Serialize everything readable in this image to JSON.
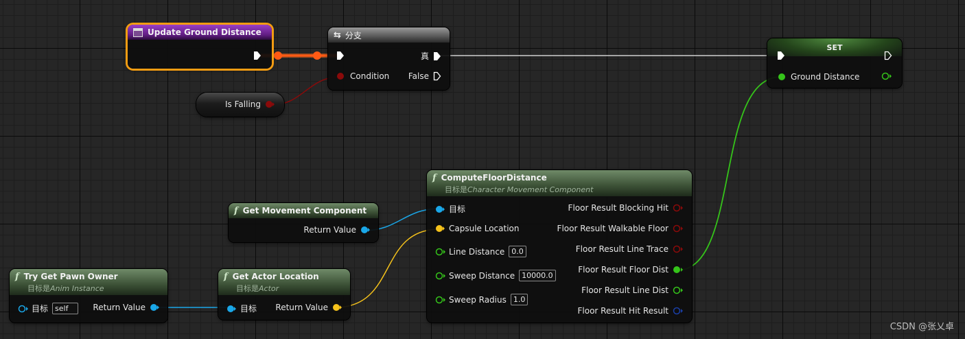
{
  "colors": {
    "exec": "#ffffff",
    "bool_pin": "#8a0a0a",
    "float_pin": "#35c41a",
    "object_pin": "#1aa7e8",
    "vector_pin": "#f5c21b",
    "struct_pin": "#1a3fa8",
    "event_header": "#7a1fa6",
    "selection_outline": "#f39c12",
    "exec_wire_active": "#ff5a14"
  },
  "nodes": {
    "update_ground_distance": {
      "title": "Update Ground Distance",
      "icon": "event-icon"
    },
    "branch": {
      "title": "分支",
      "icon": "branch-icon",
      "condition_label": "Condition",
      "true_label": "真",
      "false_label": "False"
    },
    "is_falling": {
      "label": "Is Falling"
    },
    "set": {
      "title": "SET",
      "var_label": "Ground Distance"
    },
    "get_movement_component": {
      "title": "Get Movement Component",
      "return_label": "Return Value"
    },
    "compute_floor_distance": {
      "title": "ComputeFloorDistance",
      "subtitle_prefix": "目标是",
      "subtitle": "Character Movement Component",
      "inputs": {
        "target": "目标",
        "capsule_location": "Capsule Location",
        "line_distance": "Line Distance",
        "line_distance_value": "0.0",
        "sweep_distance": "Sweep Distance",
        "sweep_distance_value": "10000.0",
        "sweep_radius": "Sweep Radius",
        "sweep_radius_value": "1.0"
      },
      "outputs": {
        "blocking_hit": "Floor Result Blocking Hit",
        "walkable_floor": "Floor Result Walkable Floor",
        "line_trace": "Floor Result Line Trace",
        "floor_dist": "Floor Result Floor Dist",
        "line_dist": "Floor Result Line Dist",
        "hit_result": "Floor Result Hit Result"
      }
    },
    "try_get_pawn_owner": {
      "title": "Try Get Pawn Owner",
      "subtitle_prefix": "目标是",
      "subtitle": "Anim Instance",
      "target_label": "目标",
      "target_value": "self",
      "return_label": "Return Value"
    },
    "get_actor_location": {
      "title": "Get Actor Location",
      "subtitle_prefix": "目标是",
      "subtitle": "Actor",
      "target_label": "目标",
      "return_label": "Return Value"
    }
  },
  "watermark": "CSDN @张乂卓"
}
